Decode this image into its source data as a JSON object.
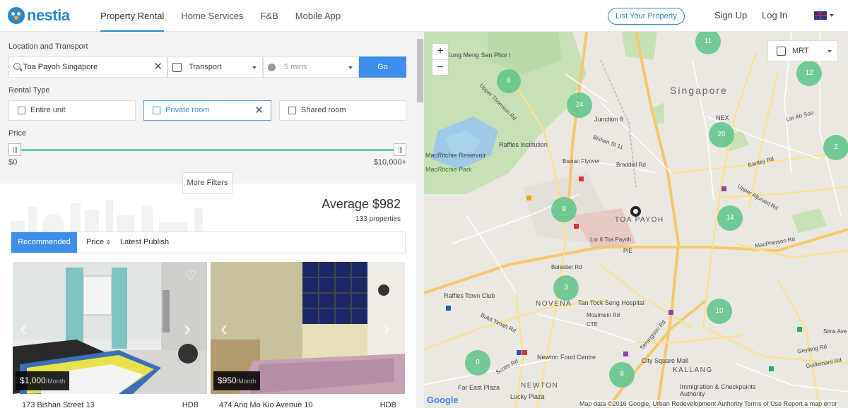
{
  "header": {
    "logo_text": "nestia",
    "nav": [
      "Property Rental",
      "Home Services",
      "F&B",
      "Mobile App"
    ],
    "list_property": "List Your Property",
    "sign_up": "Sign Up",
    "log_in": "Log In",
    "language_icon": "uk-flag-icon"
  },
  "filters": {
    "location_label": "Location and Transport",
    "search_value": "Toa Payoh Singapore",
    "transport": "Transport",
    "time": "5 mins",
    "go": "Go",
    "rental_type_label": "Rental Type",
    "rental_types": [
      "Entire unit",
      "Private room",
      "Shared room"
    ],
    "selected_rental_type": "Private room",
    "price_label": "Price",
    "price_min": "$0",
    "price_max": "$10,000+",
    "more_filters": "More Filters"
  },
  "results": {
    "average": "Average $982",
    "count": "133 properties",
    "sort": [
      "Recommended",
      "Price",
      "Latest Publish"
    ],
    "listings": [
      {
        "price": "$1,000",
        "period": "/Month",
        "address": "173 Bishan Street 13",
        "type": "HDB"
      },
      {
        "price": "$950",
        "period": "/Month",
        "address": "474 Ang Mo Kio Avenue 10",
        "type": "HDB"
      }
    ]
  },
  "map": {
    "transit_filter": "MRT",
    "clusters": [
      "6",
      "24",
      "9",
      "3",
      "0",
      "9",
      "11",
      "12",
      "20",
      "2",
      "14",
      "10"
    ],
    "labels": {
      "singapore": "Singapore",
      "toa_payoh": "TOA PAYOH",
      "novena": "NOVENA",
      "kallang": "KALLANG",
      "newton": "NEWTON",
      "nex": "NEX",
      "junction8": "Junction 8",
      "raffles_inst": "Raffles Institution",
      "macritchie_res": "MacRitchie Reservoir",
      "macritchie_park": "MacRitchie Park",
      "monastery": "Kong Meng San Phor Kark See Monastery",
      "bishan_flyover": "Bishan Flyover",
      "raffles_town": "Raffles Town Club",
      "ttsh": "Tan Tock Seng Hospital",
      "newton_fc": "Newton Food Centre",
      "city_square": "City Square Mall",
      "far_east": "Far East Plaza",
      "lucky": "Lucky Plaza",
      "immigration": "Immigration & Checkpoints Authority",
      "balestier": "Balestier Rd",
      "macpherson": "MacPherson Rd",
      "pie": "PIE",
      "cte": "CTE",
      "bukit_timah": "Bukit Timah Rd",
      "serangoon": "Serangoon Rd",
      "geylang": "Geylang Rd",
      "sims": "Sims Ave",
      "guillemard": "Guillemard Rd",
      "braddell": "Braddell Rd",
      "thomson": "Upper Thomson Rd",
      "aljunied": "Upper Aljunied Rd",
      "scotts": "Scotts Rd",
      "moulmein": "Moulmein Rd",
      "lor6": "Lor 6 Toa Payoh",
      "bishan_st11": "Bishan St 11",
      "bartley": "Bartley Rd",
      "lor_ah_soo": "Lor Ah Soo"
    },
    "attribution": "Map data ©2016 Google, Urban Redevelopment Authority   Terms of Use   Report a map error",
    "google": "Google"
  }
}
